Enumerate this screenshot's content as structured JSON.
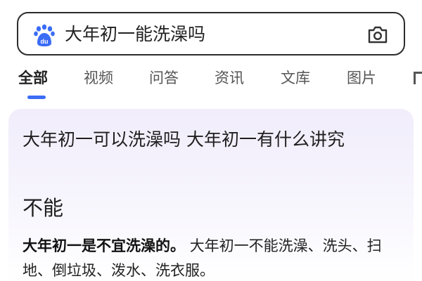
{
  "search": {
    "query": "大年初一能洗澡吗",
    "logo_icon": "baidu-paw-icon",
    "camera_icon": "camera-icon",
    "accent_color": "#3b6cf6"
  },
  "tabs": [
    {
      "label": "全部",
      "active": true
    },
    {
      "label": "视频",
      "active": false
    },
    {
      "label": "问答",
      "active": false
    },
    {
      "label": "资讯",
      "active": false
    },
    {
      "label": "文库",
      "active": false
    },
    {
      "label": "图片",
      "active": false
    }
  ],
  "result": {
    "title": "大年初一可以洗澡吗 大年初一有什么讲究",
    "answer": "不能",
    "summary_bold": "大年初一是不宜洗澡的。",
    "summary_text": "大年初一不能洗澡、洗头、扫地、倒垃圾、泼水、洗衣服。"
  }
}
